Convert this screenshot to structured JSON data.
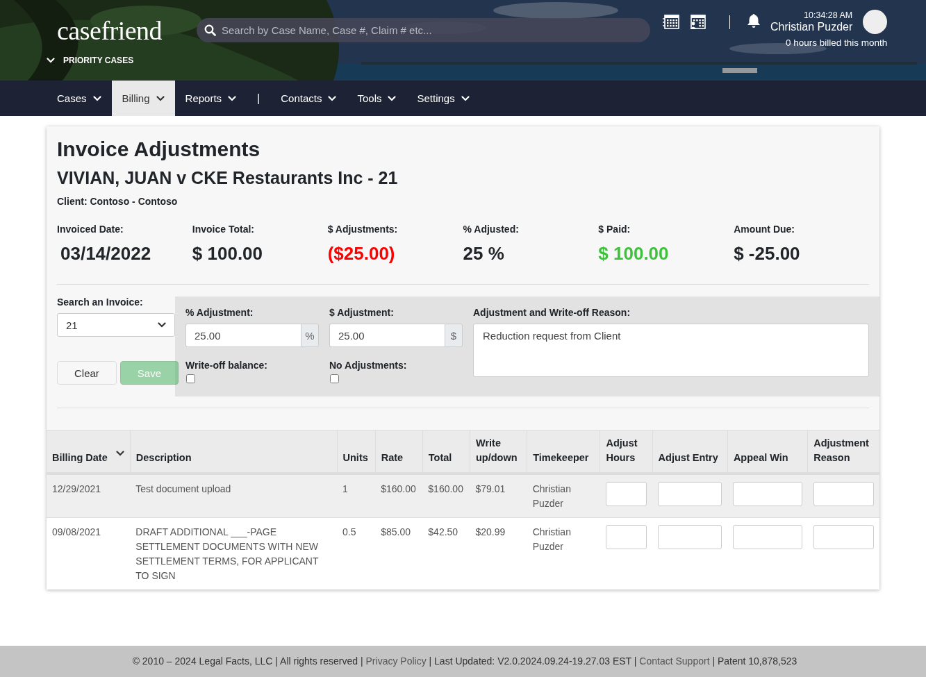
{
  "header": {
    "logo": "casefriend",
    "priority": "PRIORITY CASES",
    "search": {
      "placeholder": "Search by Case Name, Case #, Claim # etc..."
    },
    "time": "10:34:28 AM",
    "user": "Christian Puzder",
    "hours": "0 hours billed this month"
  },
  "nav": [
    {
      "kind": "menu",
      "label": "Cases",
      "selected": false
    },
    {
      "kind": "menu",
      "label": "Billing",
      "selected": true
    },
    {
      "kind": "menu",
      "label": "Reports",
      "selected": false
    },
    {
      "kind": "separator",
      "label": "|"
    },
    {
      "kind": "menu",
      "label": "Contacts",
      "selected": false
    },
    {
      "kind": "menu",
      "label": "Tools",
      "selected": false
    },
    {
      "kind": "menu",
      "label": "Settings",
      "selected": false
    }
  ],
  "page": {
    "title": "Invoice Adjustments",
    "case_title": "VIVIAN, JUAN v CKE Restaurants Inc - 21",
    "client": "Client: Contoso - Contoso",
    "summary": [
      {
        "label": "Invoiced Date:",
        "value": "03/14/2022",
        "color": "#212529"
      },
      {
        "label": "Invoice Total:",
        "value": "$ 100.00",
        "color": "#212529"
      },
      {
        "label": "$ Adjustments:",
        "value": "($25.00)",
        "color": "#ff0000"
      },
      {
        "label": "% Adjusted:",
        "value": "25 %",
        "color": "#212529"
      },
      {
        "label": "$ Paid:",
        "value": "$ 100.00",
        "color": "#3ec23c"
      },
      {
        "label": "Amount Due:",
        "value": "$ -25.00",
        "color": "#212529"
      }
    ],
    "form": {
      "search_label": "Search an Invoice:",
      "invoice": "21",
      "buttons": [
        {
          "label": "Clear",
          "kind": "default",
          "disabled": false
        },
        {
          "label": "Save",
          "kind": "success",
          "disabled": true
        }
      ],
      "percent": {
        "label": "% Adjustment:",
        "value": "25.00",
        "unit": "%"
      },
      "dollar": {
        "label": "$ Adjustment:",
        "value": "25.00",
        "unit": "$"
      },
      "write_off": {
        "label": "Write-off balance:",
        "checked": false
      },
      "no_adjustments": {
        "label": "No Adjustments:",
        "checked": false
      },
      "reason": {
        "label": "Adjustment and Write-off Reason:",
        "value": "Reduction request from Client"
      }
    }
  },
  "table": {
    "columns": [
      {
        "label": "Billing Date",
        "kind": "text",
        "sorted": true
      },
      {
        "label": "Description",
        "kind": "text",
        "sorted": false
      },
      {
        "label": "Units",
        "kind": "text",
        "sorted": false
      },
      {
        "label": "Rate",
        "kind": "text",
        "sorted": false
      },
      {
        "label": "Total",
        "kind": "text",
        "sorted": false
      },
      {
        "label": "Write up/down",
        "kind": "text",
        "sorted": false
      },
      {
        "label": "Timekeeper",
        "kind": "text",
        "sorted": false
      },
      {
        "label": "Adjust Hours",
        "kind": "input",
        "sorted": false
      },
      {
        "label": "Adjust Entry",
        "kind": "input",
        "sorted": false
      },
      {
        "label": "Appeal Win",
        "kind": "input",
        "sorted": false
      },
      {
        "label": "Adjustment Reason",
        "kind": "input",
        "sorted": false
      }
    ],
    "rows": [
      {
        "cells": [
          "12/29/2021",
          "Test document upload",
          "1",
          "$160.00",
          "$160.00",
          "$79.01",
          "Christian Puzder"
        ]
      },
      {
        "cells": [
          "09/08/2021",
          "DRAFT ADDITIONAL ___-PAGE SETTLEMENT DOCUMENTS WITH NEW SETTLEMENT TERMS, FOR APPLICANT TO SIGN",
          "0.5",
          "$85.00",
          "$42.50",
          "$20.99",
          "Christian Puzder"
        ]
      }
    ]
  },
  "footer": [
    {
      "kind": "text",
      "text": "© 2010 – 2024 Legal Facts, LLC | All rights reserved | "
    },
    {
      "kind": "link",
      "text": "Privacy Policy"
    },
    {
      "kind": "text",
      "text": " | Last Updated: V2.0.2024.09.24-19.27.03 EST | "
    },
    {
      "kind": "link",
      "text": "Contact Support"
    },
    {
      "kind": "text",
      "text": " | Patent 10,878,523"
    }
  ]
}
